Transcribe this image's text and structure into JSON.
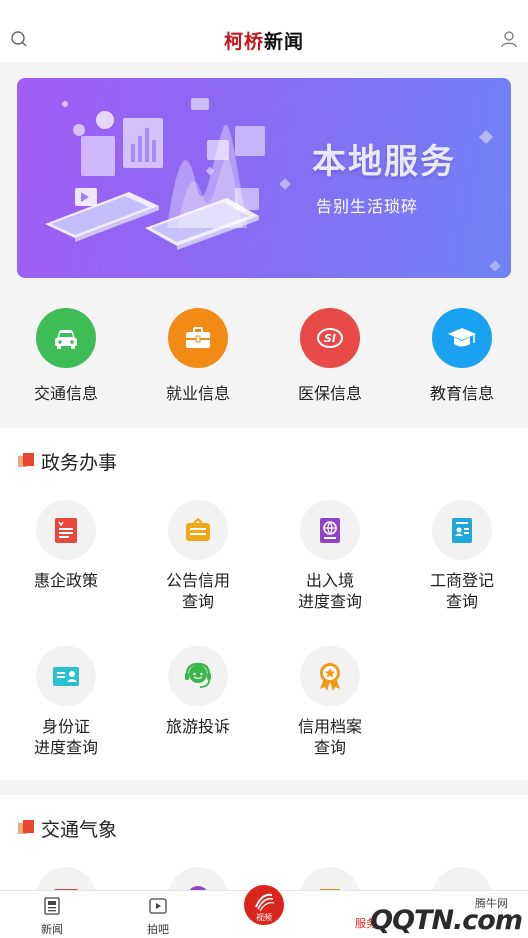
{
  "header": {
    "title_part1": "柯桥",
    "title_part2": "新闻",
    "left_icon": "search-icon",
    "right_icon": "user-icon"
  },
  "banner": {
    "title": "本地服务",
    "subtitle": "告别生活琐碎"
  },
  "services": [
    {
      "label": "交通信息",
      "icon": "car-icon",
      "color": "#3ebd57"
    },
    {
      "label": "就业信息",
      "icon": "briefcase-icon",
      "color": "#f28a16"
    },
    {
      "label": "医保信息",
      "icon": "si-insurance-icon",
      "color": "#e84a48"
    },
    {
      "label": "教育信息",
      "icon": "graduation-cap-icon",
      "color": "#1aa1f0"
    }
  ],
  "gov_section": {
    "title": "政务办事",
    "items": [
      {
        "label": "惠企政策",
        "icon": "policy-document-icon",
        "color": "#e8473d"
      },
      {
        "label": "公告信用查询",
        "label_line1": "公告信用",
        "label_line2": "查询",
        "icon": "notice-board-icon",
        "color": "#f0a816"
      },
      {
        "label": "出入境进度查询",
        "label_line1": "出入境",
        "label_line2": "进度查询",
        "icon": "passport-icon",
        "color": "#8e44c8"
      },
      {
        "label": "工商登记查询",
        "label_line1": "工商登记",
        "label_line2": "查询",
        "icon": "license-icon",
        "color": "#21a7d8"
      },
      {
        "label": "身份证进度查询",
        "label_line1": "身份证",
        "label_line2": "进度查询",
        "icon": "id-card-icon",
        "color": "#2cc1cf"
      },
      {
        "label": "旅游投诉",
        "icon": "headset-icon",
        "color": "#3ab54a"
      },
      {
        "label": "信用档案查询",
        "label_line1": "信用档案",
        "label_line2": "查询",
        "icon": "award-badge-icon",
        "color": "#f19a17"
      }
    ]
  },
  "traffic_section": {
    "title": "交通气象"
  },
  "bottom_nav": {
    "items": [
      {
        "label": "新闻",
        "icon": "news-icon"
      },
      {
        "label": "拍吧",
        "icon": "video-icon"
      }
    ],
    "center_label": "视频",
    "center_icon": "kq-logo-icon",
    "partial_label": "服务"
  },
  "watermark": {
    "top_text": "腾牛网",
    "logo_text": "QQTN.com"
  }
}
